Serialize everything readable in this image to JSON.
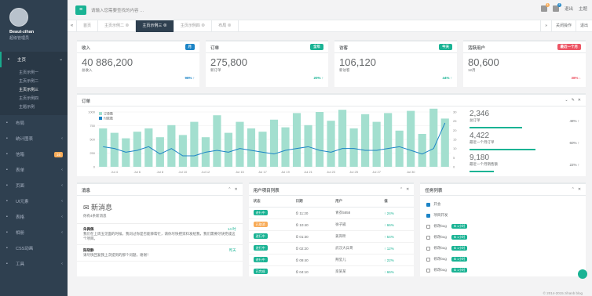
{
  "sidebar": {
    "name": "Beaut-zihan",
    "role": "超级管理员",
    "items": [
      {
        "icon": "home-icon",
        "label": "主页",
        "arrow": "⌄"
      },
      {
        "icon": "columns-icon",
        "label": "布局",
        "arrow": ""
      },
      {
        "icon": "chart-icon",
        "label": "统计图表",
        "arrow": "‹"
      },
      {
        "icon": "envelope-icon",
        "label": "信箱",
        "arrow": "",
        "badge": "16"
      },
      {
        "icon": "edit-icon",
        "label": "表单",
        "arrow": "‹"
      },
      {
        "icon": "desktop-icon",
        "label": "页面",
        "arrow": "‹"
      },
      {
        "icon": "flask-icon",
        "label": "UI元素",
        "arrow": "‹"
      },
      {
        "icon": "table-icon",
        "label": "表格",
        "arrow": "‹"
      },
      {
        "icon": "picture-icon",
        "label": "相册",
        "arrow": "‹"
      },
      {
        "icon": "magic-icon",
        "label": "CSS动画",
        "arrow": ""
      },
      {
        "icon": "cutlery-icon",
        "label": "工具",
        "arrow": "‹"
      }
    ],
    "home_sub": [
      "主页示例一",
      "主页示例二",
      "主页示例三",
      "主页示例四",
      "主题示例"
    ]
  },
  "topbar": {
    "search_placeholder": "请输入您需要查找的内容 …",
    "messages_badge": "4",
    "alerts_badge": "8",
    "exit": "退出",
    "right_label": "主题"
  },
  "tabs": [
    "首页",
    "主页示例二",
    "主页示例三",
    "主页示例四",
    "布局"
  ],
  "tabbar_right": [
    "关闭操作",
    "退出"
  ],
  "stats": [
    {
      "title": "收入",
      "label": "月",
      "label_color": "#1c84c6",
      "value": "40 886,200",
      "sub": "总收入",
      "pct": "98% ↑",
      "pct_color": "#1c84c6"
    },
    {
      "title": "订单",
      "label": "全年",
      "label_color": "#1ab394",
      "value": "275,800",
      "sub": "新订单",
      "pct": "20% ↑",
      "pct_color": "#1ab394"
    },
    {
      "title": "访客",
      "label": "今天",
      "label_color": "#1ab394",
      "value": "106,120",
      "sub": "新访客",
      "pct": "44% ↑",
      "pct_color": "#1ab394"
    },
    {
      "title": "活跃用户",
      "label": "最近一个月",
      "label_color": "#ed5565",
      "value": "80,600",
      "sub": "12月",
      "pct": "38% ↓",
      "pct_color": "#ed5565"
    }
  ],
  "chart_panel": {
    "title": "订单",
    "tools": [
      "⌄",
      "✎",
      "✕"
    ]
  },
  "chart_data": {
    "type": "bar",
    "categories": [
      "Jul 3",
      "Jul 4",
      "Jul 5",
      "Jul 6",
      "Jul 7",
      "Jul 8",
      "Jul 9",
      "Jul 10",
      "Jul 11",
      "Jul 12",
      "Jul 13",
      "Jul 14",
      "Jul 15",
      "Jul 16",
      "Jul 17",
      "Jul 18",
      "Jul 19",
      "Jul 20",
      "Jul 21",
      "Jul 22",
      "Jul 23",
      "Jul 24",
      "Jul 25",
      "Jul 26",
      "Jul 27",
      "Jul 28",
      "Jul 29",
      "Jul 30",
      "Jul 31",
      "Aug 1",
      "Aug 2"
    ],
    "xtick_labels": [
      "Jul 4",
      "Jul 6",
      "Jul 8",
      "Jul 10",
      "Jul 12",
      "Jul 15",
      "Jul 17",
      "Jul 19",
      "Jul 21",
      "Jul 23",
      "Jul 25",
      "Jul 27",
      "Jul 30"
    ],
    "series": [
      {
        "name": "订单数",
        "type": "bar",
        "axis": "left",
        "color": "#a3dfcf",
        "values": [
          700,
          620,
          520,
          640,
          700,
          540,
          760,
          580,
          820,
          540,
          940,
          620,
          820,
          700,
          640,
          860,
          720,
          980,
          760,
          1000,
          840,
          1040,
          700,
          960,
          820,
          980,
          660,
          1020,
          600,
          1060,
          880
        ]
      },
      {
        "name": "付款数",
        "type": "line",
        "axis": "right",
        "color": "#1c84c6",
        "values": [
          11,
          10,
          8,
          9,
          11,
          7,
          10,
          6,
          6,
          8,
          9,
          8,
          10,
          9,
          8,
          7,
          9,
          10,
          11,
          9,
          8,
          10,
          10,
          9,
          9,
          10,
          11,
          9,
          7,
          10,
          24
        ]
      }
    ],
    "ylim": [
      0,
      1000
    ],
    "yticks": [
      0,
      250,
      500,
      750,
      1000
    ],
    "y2lim": [
      0,
      30
    ],
    "y2ticks": [
      0,
      5,
      10,
      15,
      20,
      25,
      30
    ]
  },
  "right_stats": [
    {
      "value": "2,346",
      "label": "总订单",
      "pct": "48% ↑",
      "bar": 0.48
    },
    {
      "value": "4,422",
      "label": "最近一个月订单",
      "pct": "60% ↑",
      "bar": 0.6
    },
    {
      "value": "9,180",
      "label": "最近一个月销售额",
      "pct": "22% ↑",
      "bar": 0.22
    }
  ],
  "messages": {
    "title": "消息",
    "head": "新消息",
    "sub": "你有4条新消息",
    "items": [
      {
        "from": "朱佩佩",
        "time": "14 时",
        "text": "我们在上周五见面的时候，我问过你是否能够帮忙，请你尽快把资料发给我，我们需要尽快完成这个项目。"
      },
      {
        "from": "陈晓静",
        "time": "昨天",
        "text": "请尽快回复我上次提到的那个问题，谢谢！"
      }
    ]
  },
  "projects": {
    "title": "用户项目列表",
    "headers": [
      "状态",
      "日期",
      "用户",
      "值"
    ],
    "rows": [
      {
        "status": "进行中",
        "status_color": "#1ab394",
        "date": "11:20",
        "user": "青衣5858",
        "value": "↑ 24%"
      },
      {
        "status": "已取消",
        "status_color": "#f8ac59",
        "date": "10:40",
        "user": "徐子崴",
        "value": "↑ 66%"
      },
      {
        "status": "进行中",
        "status_color": "#1ab394",
        "date": "01:30",
        "user": "姜岚昕",
        "value": "↑ 54%"
      },
      {
        "status": "进行中",
        "status_color": "#1ab394",
        "date": "02:20",
        "user": "武汉大兵哥",
        "value": "↑ 12%"
      },
      {
        "status": "进行中",
        "status_color": "#1ab394",
        "date": "09:40",
        "user": "荆莹儿",
        "value": "↑ 22%"
      },
      {
        "status": "已完成",
        "status_color": "#1ab394",
        "date": "04:10",
        "user": "栾某某",
        "value": "↑ 66%"
      }
    ]
  },
  "todos": {
    "title": "任务列表",
    "items": [
      {
        "text": "开会",
        "done": true,
        "label": ""
      },
      {
        "text": "项目开发",
        "done": true,
        "label": ""
      },
      {
        "text": "修改bug",
        "done": false,
        "label": "1小时"
      },
      {
        "text": "修改bug",
        "done": false,
        "label": "1小时"
      },
      {
        "text": "修改bug",
        "done": false,
        "label": "1小时"
      },
      {
        "text": "修改bug",
        "done": false,
        "label": "1小时"
      },
      {
        "text": "修改bug",
        "done": false,
        "label": "1小时"
      }
    ]
  },
  "footer": "© 2014-2015 zihanb blog"
}
